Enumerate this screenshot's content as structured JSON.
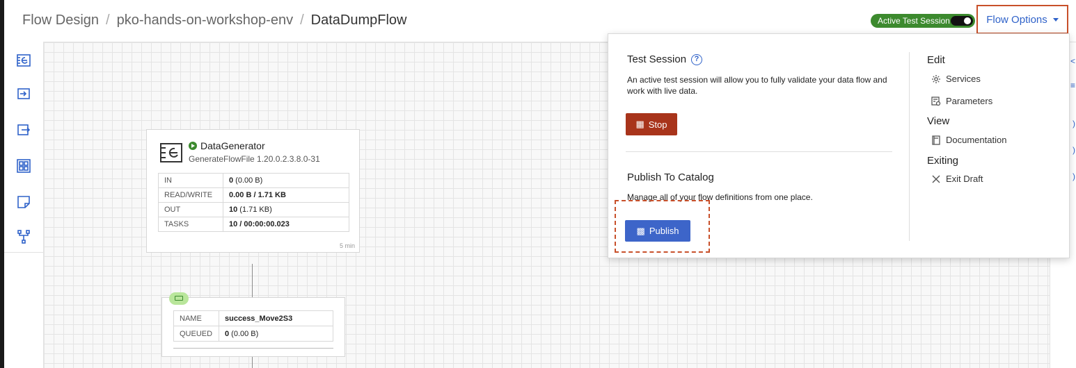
{
  "breadcrumb": {
    "root": "Flow Design",
    "env": "pko-hands-on-workshop-env",
    "flow": "DataDumpFlow",
    "separator": "/"
  },
  "header": {
    "session_label": "Active Test Session",
    "session_active": true,
    "flow_options_label": "Flow Options"
  },
  "toolbar": {
    "items": [
      "processor-icon",
      "input-port-icon",
      "output-port-icon",
      "process-group-icon",
      "label-icon",
      "funnel-icon"
    ]
  },
  "processor": {
    "name": "DataGenerator",
    "type": "GenerateFlowFile 1.20.0.2.3.8.0-31",
    "stats": [
      {
        "key": "IN",
        "value_bold": "0",
        "value_rest": " (0.00 B)"
      },
      {
        "key": "READ/WRITE",
        "value_bold": "0.00 B / 1.71 KB",
        "value_rest": ""
      },
      {
        "key": "OUT",
        "value_bold": "10",
        "value_rest": " (1.71 KB)"
      },
      {
        "key": "TASKS",
        "value_bold": "10 / 00:00:00.023",
        "value_rest": ""
      }
    ],
    "time_window": "5 min"
  },
  "connection": {
    "name_label": "NAME",
    "name_value": "success_Move2S3",
    "queued_label": "QUEUED",
    "queued_bold": "0",
    "queued_rest": " (0.00 B)"
  },
  "panel": {
    "test_session_title": "Test Session",
    "test_session_desc": "An active test session will allow you to fully validate your data flow and work with live data.",
    "stop_label": "Stop",
    "publish_title": "Publish To Catalog",
    "publish_desc": "Manage all of your flow definitions from one place.",
    "publish_label": "Publish",
    "edit_heading": "Edit",
    "services_label": "Services",
    "parameters_label": "Parameters",
    "view_heading": "View",
    "documentation_label": "Documentation",
    "exiting_heading": "Exiting",
    "exit_draft_label": "Exit Draft"
  },
  "colors": {
    "accent": "#2f62c9",
    "session_green": "#3c8a2e",
    "stop_red": "#a8341b",
    "publish_blue": "#3d65c9",
    "highlight": "#c8502a"
  }
}
